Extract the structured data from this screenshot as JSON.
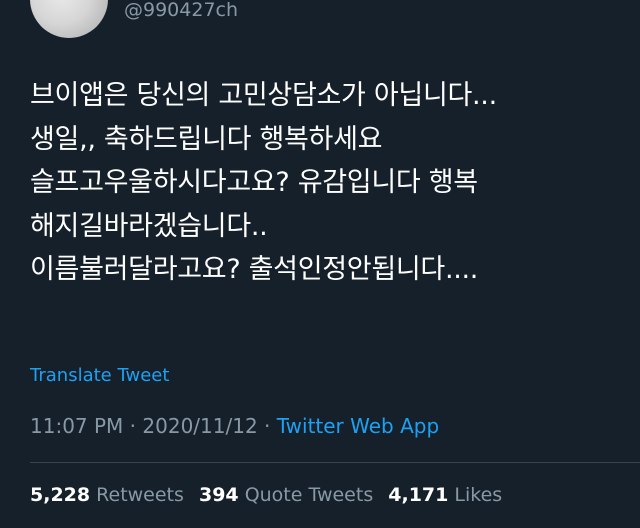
{
  "user": {
    "handle": "@990427ch"
  },
  "tweet": {
    "lines": [
      "브이앱은 당신의 고민상담소가 아닙니다...",
      "생일,, 축하드립니다 행복하세요",
      "슬프고우울하시다고요? 유감입니다 행복",
      "해지길바라겠습니다..",
      "이름불러달라고요? 출석인정안됩니다...."
    ],
    "translate_label": "Translate Tweet"
  },
  "meta": {
    "time": "11:07 PM",
    "separator": "·",
    "date": "2020/11/12",
    "app": "Twitter Web App"
  },
  "stats": {
    "retweets_count": "5,228",
    "retweets_label": "Retweets",
    "quotes_count": "394",
    "quotes_label": "Quote Tweets",
    "likes_count": "4,171",
    "likes_label": "Likes"
  },
  "colors": {
    "background": "#15202b",
    "accent": "#1da1f2",
    "secondary_text": "#8899a6",
    "divider": "#38444d"
  }
}
